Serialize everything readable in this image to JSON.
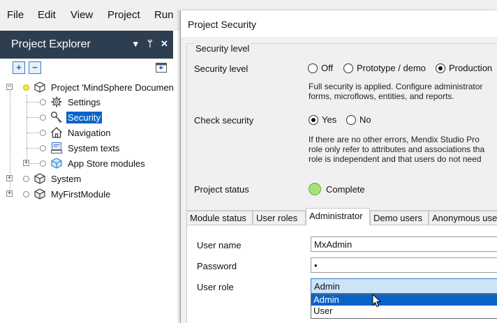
{
  "menu": [
    "File",
    "Edit",
    "View",
    "Project",
    "Run"
  ],
  "explorer": {
    "title": "Project Explorer",
    "header_buttons": [
      "▾",
      "ᛘ",
      "✕"
    ],
    "tree": {
      "project": "Project 'MindSphere Documen",
      "children": [
        "Settings",
        "Security",
        "Navigation",
        "System texts",
        "App Store modules"
      ],
      "system": "System",
      "module": "MyFirstModule"
    }
  },
  "dialog": {
    "title": "Project Security",
    "group_legend": "Security level",
    "security_level_label": "Security level",
    "security_options": [
      "Off",
      "Prototype / demo",
      "Production"
    ],
    "security_selected": "Production",
    "security_desc": [
      "Full security is applied. Configure administrator",
      "forms, microflows, entities, and reports."
    ],
    "check_security_label": "Check security",
    "check_options": [
      "Yes",
      "No"
    ],
    "check_selected": "Yes",
    "check_desc": [
      "If there are no other errors, Mendix Studio Pro",
      "role only refer to attributes and associations tha",
      "role is independent and that users do not need"
    ],
    "project_status_label": "Project status",
    "project_status_value": "Complete",
    "status_color": "#a8e07a",
    "tabs": [
      "Module status",
      "User roles",
      "Administrator",
      "Demo users",
      "Anonymous use"
    ],
    "active_tab": "Administrator",
    "user_name_label": "User name",
    "user_name_value": "MxAdmin",
    "password_label": "Password",
    "password_value": "•",
    "user_role_label": "User role",
    "user_role_value": "Admin",
    "user_role_options": [
      "Admin",
      "User"
    ],
    "highlighted_option": "Admin"
  },
  "colors": {
    "explorer_header": "#2d3e50",
    "selection": "#0a64c8"
  }
}
